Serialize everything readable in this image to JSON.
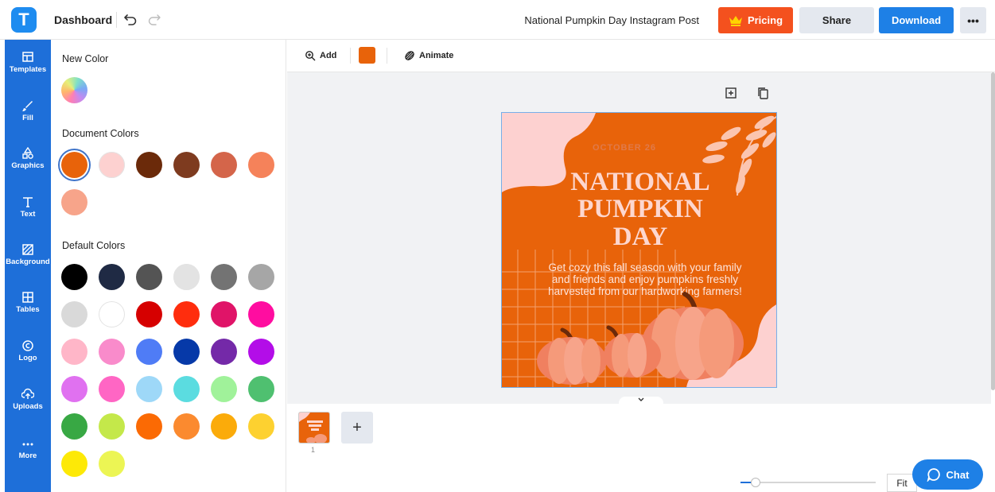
{
  "header": {
    "logo_letter": "T",
    "dashboard_label": "Dashboard",
    "document_title": "National Pumpkin Day Instagram Post",
    "pricing_label": "Pricing",
    "share_label": "Share",
    "download_label": "Download",
    "more_label": "•••"
  },
  "sidenav": {
    "items": [
      {
        "label": "Templates",
        "icon": "templates-icon"
      },
      {
        "label": "Fill",
        "icon": "brush-icon"
      },
      {
        "label": "Graphics",
        "icon": "shapes-icon"
      },
      {
        "label": "Text",
        "icon": "text-icon"
      },
      {
        "label": "Background",
        "icon": "background-icon"
      },
      {
        "label": "Tables",
        "icon": "table-icon"
      },
      {
        "label": "Logo",
        "icon": "logo-icon"
      },
      {
        "label": "Uploads",
        "icon": "upload-icon"
      },
      {
        "label": "More",
        "icon": "more-icon"
      }
    ]
  },
  "panel": {
    "new_color_heading": "New Color",
    "document_colors_heading": "Document Colors",
    "default_colors_heading": "Default Colors",
    "document_colors": [
      "#e8630a",
      "#fdd1d0",
      "#6b2a0a",
      "#7e3b1f",
      "#d4654a",
      "#f5825a",
      "#f7a48a"
    ],
    "selected_document_color": "#e8630a",
    "default_colors": [
      "#000000",
      "#1f2a44",
      "#545454",
      "#e3e3e3",
      "#737373",
      "#a6a6a6",
      "#d9d9d9",
      "#ffffff",
      "#d60000",
      "#ff2d0d",
      "#e01468",
      "#ff0da0",
      "#ffb6c8",
      "#f98bcb",
      "#4f7cf6",
      "#0639a8",
      "#7429a8",
      "#b30de8",
      "#e071f0",
      "#ff66c4",
      "#9ed8f8",
      "#5bdce0",
      "#a0f29a",
      "#4fc070",
      "#38a844",
      "#c4e84a",
      "#fb6a04",
      "#fb8a2f",
      "#fbab0a",
      "#fdd130",
      "#fde907",
      "#ecf554"
    ]
  },
  "context_bar": {
    "add_label": "Add",
    "current_color": "#e8630a",
    "animate_label": "Animate"
  },
  "artwork": {
    "date_text": "OCTOBER 26",
    "title_lines": [
      "NATIONAL",
      "PUMPKIN",
      "DAY"
    ],
    "body_lines": [
      "Get cozy this fall season with your family",
      "and friends and enjoy pumpkins freshly",
      "harvested from our hardworking farmers!"
    ]
  },
  "pages": {
    "page_number": "1",
    "add_page_label": "+"
  },
  "zoom": {
    "fit_label": "Fit",
    "level_fraction": 0.08
  },
  "chat_label": "Chat"
}
